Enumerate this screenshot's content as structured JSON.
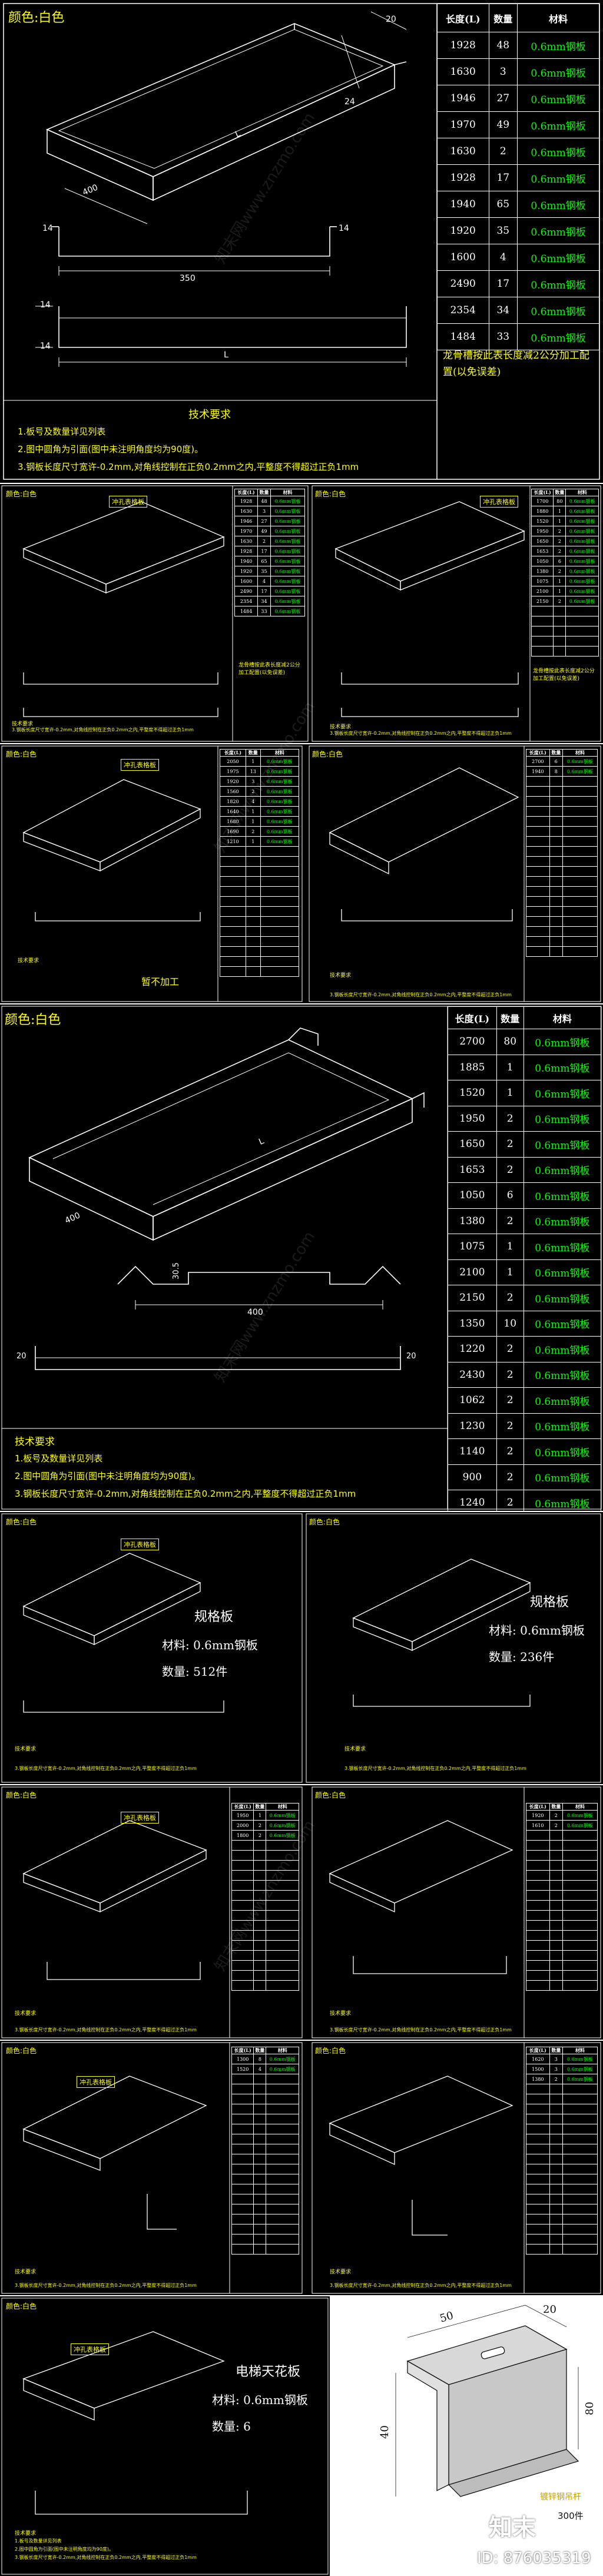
{
  "colors": {
    "background": "#000000",
    "line": "#ffffff",
    "accent_yellow": "#ffff00",
    "accent_green": "#00ff00",
    "accent_cyan": "#00ffff",
    "separator": "#ffffff"
  },
  "watermark": "知末网www.znzmo.com",
  "sheet1": {
    "color_label": "颜色:白色",
    "dims": {
      "d14a": "14",
      "d14b": "14",
      "d14c": "14",
      "d14d": "14",
      "d350": "350",
      "d400": "400",
      "L": "L",
      "L2": "L",
      "d24": "24",
      "d20": "20"
    },
    "headers": [
      "长度(L)",
      "数量",
      "材料"
    ],
    "rows": [
      [
        "1928",
        "48",
        "0.6mm钢板"
      ],
      [
        "1630",
        "3",
        "0.6mm钢板"
      ],
      [
        "1946",
        "27",
        "0.6mm钢板"
      ],
      [
        "1970",
        "49",
        "0.6mm钢板"
      ],
      [
        "1630",
        "2",
        "0.6mm钢板"
      ],
      [
        "1928",
        "17",
        "0.6mm钢板"
      ],
      [
        "1940",
        "65",
        "0.6mm钢板"
      ],
      [
        "1920",
        "35",
        "0.6mm钢板"
      ],
      [
        "1600",
        "4",
        "0.6mm钢板"
      ],
      [
        "2490",
        "17",
        "0.6mm钢板"
      ],
      [
        "2354",
        "34",
        "0.6mm钢板"
      ],
      [
        "1484",
        "33",
        "0.6mm钢板"
      ]
    ],
    "note": "龙骨槽按此表长度减2公分加工配置(以免误差)",
    "req_title": "技术要求",
    "req_lines": [
      "1.板号及数量详见列表",
      "2.图中圆角为引面(图中未注明角度均为90度)。",
      "3.钢板长度尺寸宽许-0.2mm,对角线控制在正负0.2mm之内,平整度不得超过正负1mm"
    ]
  },
  "sheet2": {
    "left_label": "颜色:白色",
    "right_label": "颜色:白色",
    "tag": "冲孔表格板",
    "tag2": "冲孔表格板",
    "headers": [
      "长度(L)",
      "数量",
      "材料"
    ],
    "rows": [
      [
        "1928",
        "48",
        "0.6mm钢板"
      ],
      [
        "1630",
        "3",
        "0.6mm钢板"
      ],
      [
        "1946",
        "27",
        "0.6mm钢板"
      ],
      [
        "1970",
        "49",
        "0.6mm钢板"
      ],
      [
        "1630",
        "2",
        "0.6mm钢板"
      ],
      [
        "1928",
        "17",
        "0.6mm钢板"
      ],
      [
        "1940",
        "65",
        "0.6mm钢板"
      ],
      [
        "1920",
        "35",
        "0.6mm钢板"
      ],
      [
        "1600",
        "4",
        "0.6mm钢板"
      ],
      [
        "2490",
        "17",
        "0.6mm钢板"
      ],
      [
        "2354",
        "34",
        "0.6mm钢板"
      ],
      [
        "1484",
        "33",
        "0.6mm钢板"
      ]
    ],
    "rows_b": [
      [
        "1700",
        "80",
        "0.6mm钢板"
      ],
      [
        "1880",
        "1",
        "0.6mm钢板"
      ],
      [
        "1520",
        "1",
        "0.6mm钢板"
      ],
      [
        "1950",
        "2",
        "0.6mm钢板"
      ],
      [
        "1650",
        "2",
        "0.6mm钢板"
      ],
      [
        "1653",
        "2",
        "0.6mm钢板"
      ],
      [
        "1050",
        "6",
        "0.6mm钢板"
      ],
      [
        "1380",
        "2",
        "0.6mm钢板"
      ],
      [
        "1075",
        "1",
        "0.6mm钢板"
      ],
      [
        "2100",
        "1",
        "0.6mm钢板"
      ],
      [
        "2150",
        "2",
        "0.6mm钢板"
      ]
    ],
    "note": "龙骨槽按此表长度减2公分加工配置(以免误差)",
    "req_title": "技术要求",
    "req_lines": [
      "1.板号及数量详见列表",
      "2.图中圆角为引面(图中未注明角度均为90度)。",
      "3.钢板长度尺寸宽许-0.2mm,对角线控制在正负0.2mm之内,平整度不得超过正负1mm"
    ]
  },
  "sheet3": {
    "left_label": "颜色:白色",
    "right_label": "颜色:白色",
    "tag": "冲孔表格板",
    "no_process": "暂不加工",
    "rows_a": [
      [
        "2050",
        "1",
        "0.6mm钢板"
      ],
      [
        "1975",
        "13",
        "0.6mm钢板"
      ],
      [
        "1920",
        "3",
        "0.6mm钢板"
      ],
      [
        "1560",
        "2",
        "0.6mm钢板"
      ],
      [
        "1820",
        "4",
        "0.6mm钢板"
      ],
      [
        "1640",
        "1",
        "0.6mm钢板"
      ],
      [
        "1680",
        "1",
        "0.6mm钢板"
      ],
      [
        "1690",
        "2",
        "0.6mm钢板"
      ],
      [
        "1210",
        "1",
        "0.6mm钢板"
      ]
    ],
    "rows_b": [
      [
        "2700",
        "6",
        "0.6mm钢板"
      ],
      [
        "1940",
        "8",
        "0.6mm钢板"
      ]
    ],
    "req_title": "技术要求",
    "req_lines": [
      "1.板号及数量详见列表",
      "2.图中圆角为引面(图中未注明角度均为90度)。",
      "3.钢板长度尺寸宽许-0.2mm,对角线控制在正负0.2mm之内,平整度不得超过正负1mm"
    ]
  },
  "sheet4": {
    "color_label": "颜色:白色",
    "dims": {
      "d400": "400",
      "d400b": "400",
      "L": "L",
      "d30": "30.5",
      "d20": "20",
      "d20b": "20"
    },
    "headers": [
      "长度(L)",
      "数量",
      "材料"
    ],
    "rows": [
      [
        "2700",
        "80",
        "0.6mm钢板"
      ],
      [
        "1885",
        "1",
        "0.6mm钢板"
      ],
      [
        "1520",
        "1",
        "0.6mm钢板"
      ],
      [
        "1950",
        "2",
        "0.6mm钢板"
      ],
      [
        "1650",
        "2",
        "0.6mm钢板"
      ],
      [
        "1653",
        "2",
        "0.6mm钢板"
      ],
      [
        "1050",
        "6",
        "0.6mm钢板"
      ],
      [
        "1380",
        "2",
        "0.6mm钢板"
      ],
      [
        "1075",
        "1",
        "0.6mm钢板"
      ],
      [
        "2100",
        "1",
        "0.6mm钢板"
      ],
      [
        "2150",
        "2",
        "0.6mm钢板"
      ],
      [
        "1350",
        "10",
        "0.6mm钢板"
      ],
      [
        "1220",
        "2",
        "0.6mm钢板"
      ],
      [
        "2430",
        "2",
        "0.6mm钢板"
      ],
      [
        "1062",
        "2",
        "0.6mm钢板"
      ],
      [
        "1230",
        "2",
        "0.6mm钢板"
      ],
      [
        "1140",
        "2",
        "0.6mm钢板"
      ],
      [
        "900",
        "2",
        "0.6mm钢板"
      ],
      [
        "1240",
        "2",
        "0.6mm钢板"
      ]
    ],
    "req_title": "技术要求",
    "req_lines": [
      "1.板号及数量详见列表",
      "2.图中圆角为引面(图中未注明角度均为90度)。",
      "3.钢板长度尺寸宽许-0.2mm,对角线控制在正负0.2mm之内,平整度不得超过正负1mm"
    ]
  },
  "sheet5": {
    "left_label": "颜色:白色",
    "right_label": "颜色:白色",
    "tag": "冲孔表格板",
    "left_title": "规格板",
    "left_material": "材料:  0.6mm钢板",
    "left_qty": "数量:  512件",
    "right_title": "规格板",
    "right_material": "材料:  0.6mm钢板",
    "right_qty": "数量:  236件",
    "req_title": "技术要求",
    "req_lines": [
      "1.板号及数量详见列表",
      "2.图中圆角为引面(图中未注明角度均为90度)。",
      "3.钢板长度尺寸宽许-0.2mm,对角线控制在正负0.2mm之内,平整度不得超过正负1mm"
    ]
  },
  "sheet6": {
    "left_label": "颜色:白色",
    "right_label": "颜色:白色",
    "tag": "冲孔表格板",
    "rows_a": [
      [
        "1950",
        "1",
        "0.6mm钢板"
      ],
      [
        "2000",
        "2",
        "0.6mm钢板"
      ],
      [
        "1800",
        "2",
        "0.6mm钢板"
      ]
    ],
    "rows_b": [
      [
        "1920",
        "2",
        "0.6mm钢板"
      ],
      [
        "1610",
        "2",
        "0.6mm钢板"
      ]
    ],
    "req_title": "技术要求",
    "req_lines": [
      "1.板号及数量详见列表",
      "2.图中圆角为引面(图中未注明角度均为90度)。",
      "3.钢板长度尺寸宽许-0.2mm,对角线控制在正负0.2mm之内,平整度不得超过正负1mm"
    ]
  },
  "sheet7": {
    "left_label": "颜色:白色",
    "right_label": "颜色:白色",
    "tag": "冲孔表格板",
    "rows_a": [
      [
        "1300",
        "8",
        "0.6mm钢板"
      ],
      [
        "1520",
        "4",
        "0.6mm钢板"
      ]
    ],
    "rows_b": [
      [
        "1620",
        "3",
        "0.6mm钢板"
      ],
      [
        "1500",
        "3",
        "0.6mm钢板"
      ],
      [
        "1380",
        "2",
        "0.6mm钢板"
      ]
    ],
    "req_title": "技术要求",
    "req_lines": [
      "1.板号及数量详见列表",
      "2.图中圆角为引面(图中未注明角度均为90度)。",
      "3.钢板长度尺寸宽许-0.2mm,对角线控制在正负0.2mm之内,平整度不得超过正负1mm"
    ]
  },
  "sheet8": {
    "color_label": "颜色:白色",
    "tag": "冲孔表格板",
    "title": "电梯天花板",
    "material": "材料:  0.6mm钢板",
    "qty": "数量:  6",
    "req_title": "技术要求",
    "req_lines": [
      "1.板号及数量详见列表",
      "2.图中圆角为引面(图中未注明角度均为90度)。",
      "3.钢板长度尺寸宽许-0.2mm,对角线控制在正负0.2mm之内,平整度不得超过正负1mm"
    ],
    "render_dims": {
      "d50": "50",
      "d20": "20",
      "d40": "40",
      "d80": "80"
    },
    "render_label": "镀锌钢吊杆",
    "render_qty": "300件"
  },
  "brand": {
    "logo": "知末",
    "id": "ID: 876035319"
  }
}
